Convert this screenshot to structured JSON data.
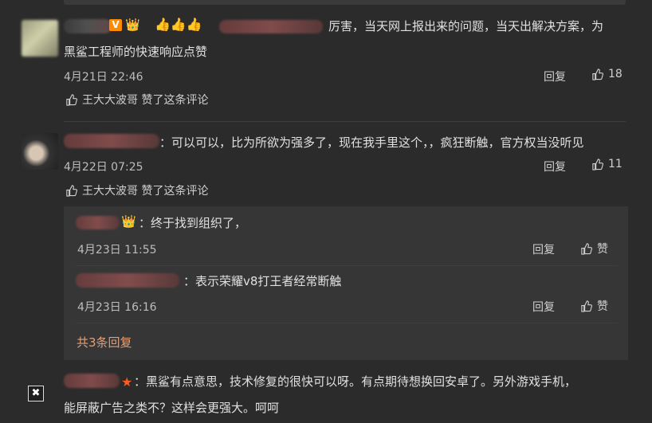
{
  "comments": [
    {
      "text_line1": "厉害，当天网上报出来的问题，当天出解决方案，为",
      "text_line2": "黑鲨工程师的快速响应点赞",
      "date": "4月21日 22:46",
      "reply_label": "回复",
      "like_count": "18",
      "liked_by": "王大大波哥 赞了这条评论",
      "emojis": "👍👍👍",
      "badge": "V"
    },
    {
      "text": "：可以可以，比为所欲为强多了，现在我手里这个，，疯狂断触，官方权当没听见",
      "date": "4月22日 07:25",
      "reply_label": "回复",
      "like_count": "11",
      "liked_by": "王大大波哥 赞了这条评论",
      "replies": [
        {
          "text": "：终于找到组织了，",
          "date": "4月23日 11:55",
          "reply_label": "回复",
          "like_label": "赞"
        },
        {
          "text": "：表示荣耀v8打王者经常断触",
          "date": "4月23日 16:16",
          "reply_label": "回复",
          "like_label": "赞"
        }
      ],
      "more_replies": "共3条回复"
    },
    {
      "text_line1": "：黑鲨有点意思，技术修复的很快可以呀。有点期待想换回安卓了。另外游戏手机，",
      "text_line2": "能屏蔽广告之类不？这样会更强大。呵呵"
    }
  ],
  "icons": {
    "close": "✖",
    "crown": "👑",
    "star": "★"
  }
}
